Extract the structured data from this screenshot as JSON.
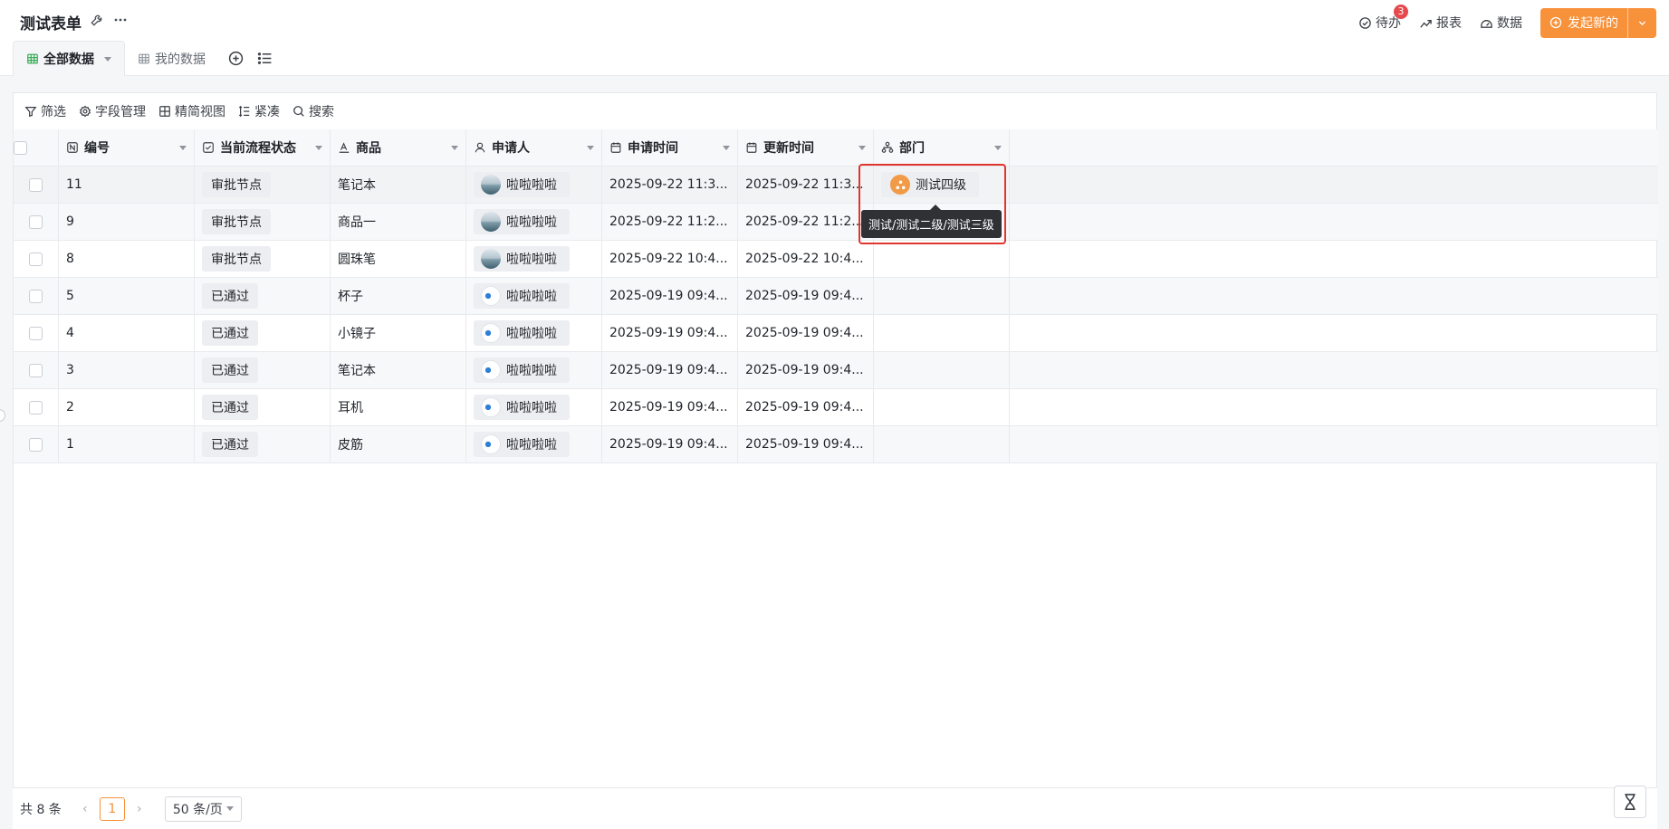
{
  "header": {
    "title": "测试表单",
    "todo_label": "待办",
    "todo_count": "3",
    "report_label": "报表",
    "data_label": "数据",
    "launch_label": "发起新的",
    "accent": "#f7913a"
  },
  "tabs": [
    {
      "label": "全部数据"
    },
    {
      "label": "我的数据"
    }
  ],
  "toolbar": {
    "filter": "筛选",
    "fields": "字段管理",
    "compact_view": "精简视图",
    "density": "紧凑",
    "search": "搜索"
  },
  "columns": [
    "编号",
    "当前流程状态",
    "商品",
    "申请人",
    "申请时间",
    "更新时间",
    "部门"
  ],
  "rows": [
    {
      "id": "11",
      "status": "审批节点",
      "product": "笔记本",
      "applicant": "啦啦啦啦",
      "created": "2025-09-22 11:3...",
      "updated": "2025-09-22 11:3...",
      "dept": "测试四级"
    },
    {
      "id": "9",
      "status": "审批节点",
      "product": "商品一",
      "applicant": "啦啦啦啦",
      "created": "2025-09-22 11:2...",
      "updated": "2025-09-22 11:2...",
      "dept": ""
    },
    {
      "id": "8",
      "status": "审批节点",
      "product": "圆珠笔",
      "applicant": "啦啦啦啦",
      "created": "2025-09-22 10:4...",
      "updated": "2025-09-22 10:4...",
      "dept": ""
    },
    {
      "id": "5",
      "status": "已通过",
      "product": "杯子",
      "applicant": "啦啦啦啦",
      "created": "2025-09-19 09:4...",
      "updated": "2025-09-19 09:4...",
      "dept": ""
    },
    {
      "id": "4",
      "status": "已通过",
      "product": "小镜子",
      "applicant": "啦啦啦啦",
      "created": "2025-09-19 09:4...",
      "updated": "2025-09-19 09:4...",
      "dept": ""
    },
    {
      "id": "3",
      "status": "已通过",
      "product": "笔记本",
      "applicant": "啦啦啦啦",
      "created": "2025-09-19 09:4...",
      "updated": "2025-09-19 09:4...",
      "dept": ""
    },
    {
      "id": "2",
      "status": "已通过",
      "product": "耳机",
      "applicant": "啦啦啦啦",
      "created": "2025-09-19 09:4...",
      "updated": "2025-09-19 09:4...",
      "dept": ""
    },
    {
      "id": "1",
      "status": "已通过",
      "product": "皮筋",
      "applicant": "啦啦啦啦",
      "created": "2025-09-19 09:4...",
      "updated": "2025-09-19 09:4...",
      "dept": ""
    }
  ],
  "tooltip": "测试/测试二级/测试三级",
  "pagination": {
    "total": "共 8 条",
    "page": "1",
    "page_size": "50 条/页"
  }
}
